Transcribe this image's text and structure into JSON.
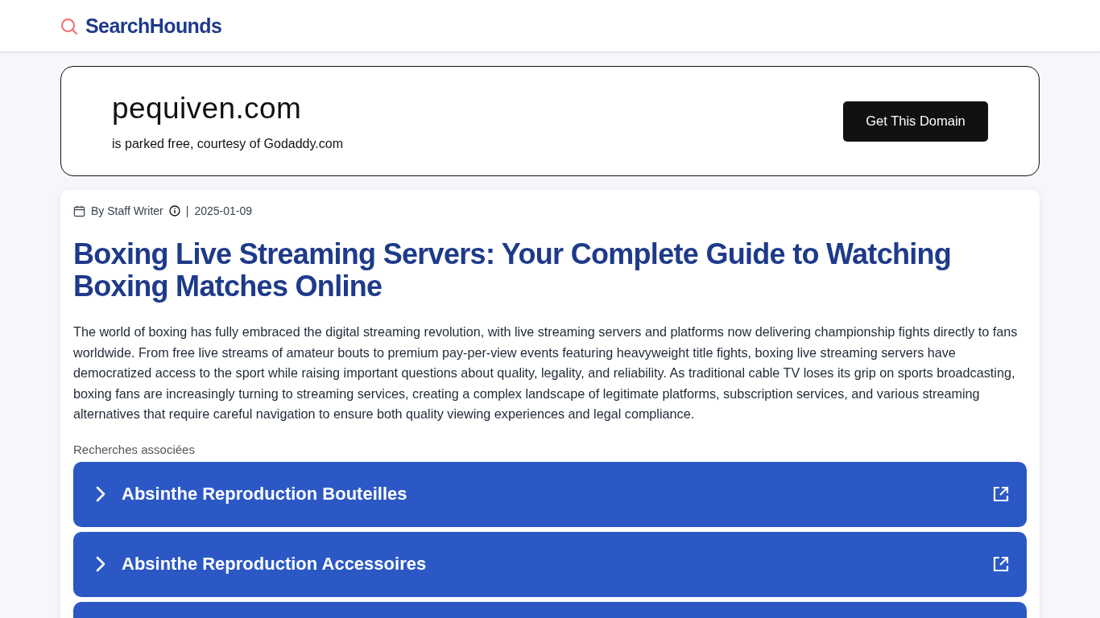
{
  "header": {
    "brand": "SearchHounds"
  },
  "domain_card": {
    "domain": "pequiven.com",
    "subtitle": "is parked free, courtesy of Godaddy.com",
    "button": "Get This Domain"
  },
  "article": {
    "author": "By Staff Writer",
    "separator": "|",
    "date": "2025-01-09",
    "title": "Boxing Live Streaming Servers: Your Complete Guide to Watching Boxing Matches Online",
    "body": "The world of boxing has fully embraced the digital streaming revolution, with live streaming servers and platforms now delivering championship fights directly to fans worldwide. From free live streams of amateur bouts to premium pay-per-view events featuring heavyweight title fights, boxing live streaming servers have democratized access to the sport while raising important questions about quality, legality, and reliability. As traditional cable TV loses its grip on sports broadcasting, boxing fans are increasingly turning to streaming services, creating a complex landscape of legitimate platforms, subscription services, and various streaming alternatives that require careful navigation to ensure both quality viewing experiences and legal compliance.",
    "related_heading": "Recherches associées",
    "related": [
      {
        "label": "Absinthe Reproduction Bouteilles"
      },
      {
        "label": "Absinthe Reproduction Accessoires"
      }
    ]
  }
}
